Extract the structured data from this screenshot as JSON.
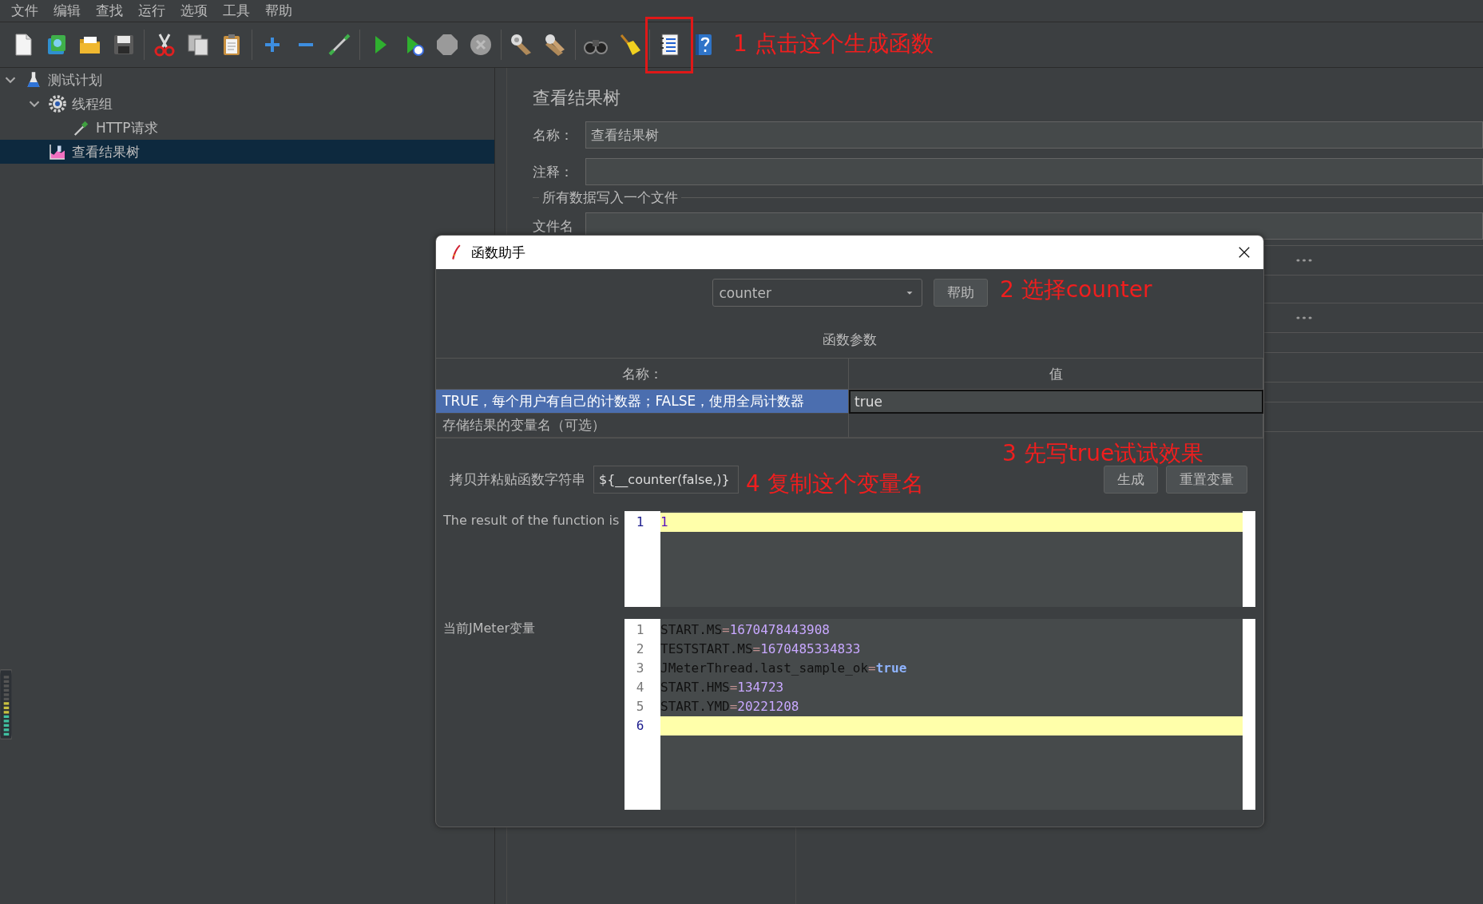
{
  "menu": [
    "文件",
    "编辑",
    "查找",
    "运行",
    "选项",
    "工具",
    "帮助"
  ],
  "toolbar_buttons": [
    {
      "highlighted": false
    },
    {
      "highlighted": false
    },
    {
      "highlighted": false
    },
    {
      "highlighted": false
    },
    {
      "highlighted": false
    },
    {
      "highlighted": false
    },
    {
      "highlighted": false
    },
    {
      "highlighted": false
    },
    {
      "highlighted": false
    },
    {
      "highlighted": false
    },
    {
      "highlighted": false
    },
    {
      "highlighted": false
    },
    {
      "highlighted": false
    },
    {
      "highlighted": false
    },
    {
      "highlighted": false
    },
    {
      "highlighted": false
    },
    {
      "highlighted": false
    },
    {
      "highlighted": false
    },
    {
      "highlighted": true
    },
    {
      "highlighted": false
    }
  ],
  "tree": [
    {
      "label": "测试计划",
      "expanded": true,
      "selected": false,
      "children": [
        {
          "label": "线程组",
          "expanded": true,
          "selected": false,
          "children": [
            {
              "label": "HTTP请求",
              "selected": false
            }
          ]
        },
        {
          "label": "查看结果树",
          "selected": true
        }
      ]
    }
  ],
  "panel": {
    "title": "查看结果树",
    "name_label": "名称：",
    "name_value": "查看结果树",
    "comment_label": "注释：",
    "file_group_title": "所有数据写入一个文件",
    "file_label": "文件名"
  },
  "dialog": {
    "title": "函数助手",
    "function": "counter",
    "help_button": "帮助",
    "params_title": "函数参数",
    "columns": [
      "名称：",
      "值"
    ],
    "params": [
      {
        "name": "TRUE，每个用户有自己的计数器；FALSE，使用全局计数器",
        "value": "true",
        "selected": true
      },
      {
        "name": "存储结果的变量名（可选）",
        "selected": false
      }
    ],
    "copy_label": "拷贝并粘贴函数字符串",
    "function_string": "${__counter(false,)}",
    "generate_button": "生成",
    "reset_button": "重置变量",
    "result_label": "The result of the function is",
    "result_lines": [
      {
        "number": "1",
        "value": "1",
        "kind": "number",
        "current": true
      }
    ],
    "vars_label": "当前JMeter变量",
    "var_lines": [
      {
        "number": "1",
        "key": "START.MS",
        "sep": "=",
        "value": "1670478443908",
        "kind": "number",
        "current": false
      },
      {
        "number": "2",
        "key": "TESTSTART.MS",
        "sep": "=",
        "value": "1670485334833",
        "kind": "number",
        "current": false
      },
      {
        "number": "3",
        "key": "JMeterThread.last_sample_ok",
        "sep": "=",
        "value": "true",
        "kind": "boolean",
        "current": false
      },
      {
        "number": "4",
        "key": "START.HMS",
        "sep": "=",
        "value": "134723",
        "kind": "number",
        "current": false
      },
      {
        "number": "5",
        "key": "START.YMD",
        "sep": "=",
        "value": "20221208",
        "kind": "number",
        "current": false
      },
      {
        "number": "6",
        "current": true
      }
    ]
  },
  "annotations": [
    {
      "text": "1 点击这个生成函数"
    },
    {
      "text": "2 选择counter"
    },
    {
      "text": "3 先写true试试效果"
    },
    {
      "text": "4 复制这个变量名"
    }
  ]
}
